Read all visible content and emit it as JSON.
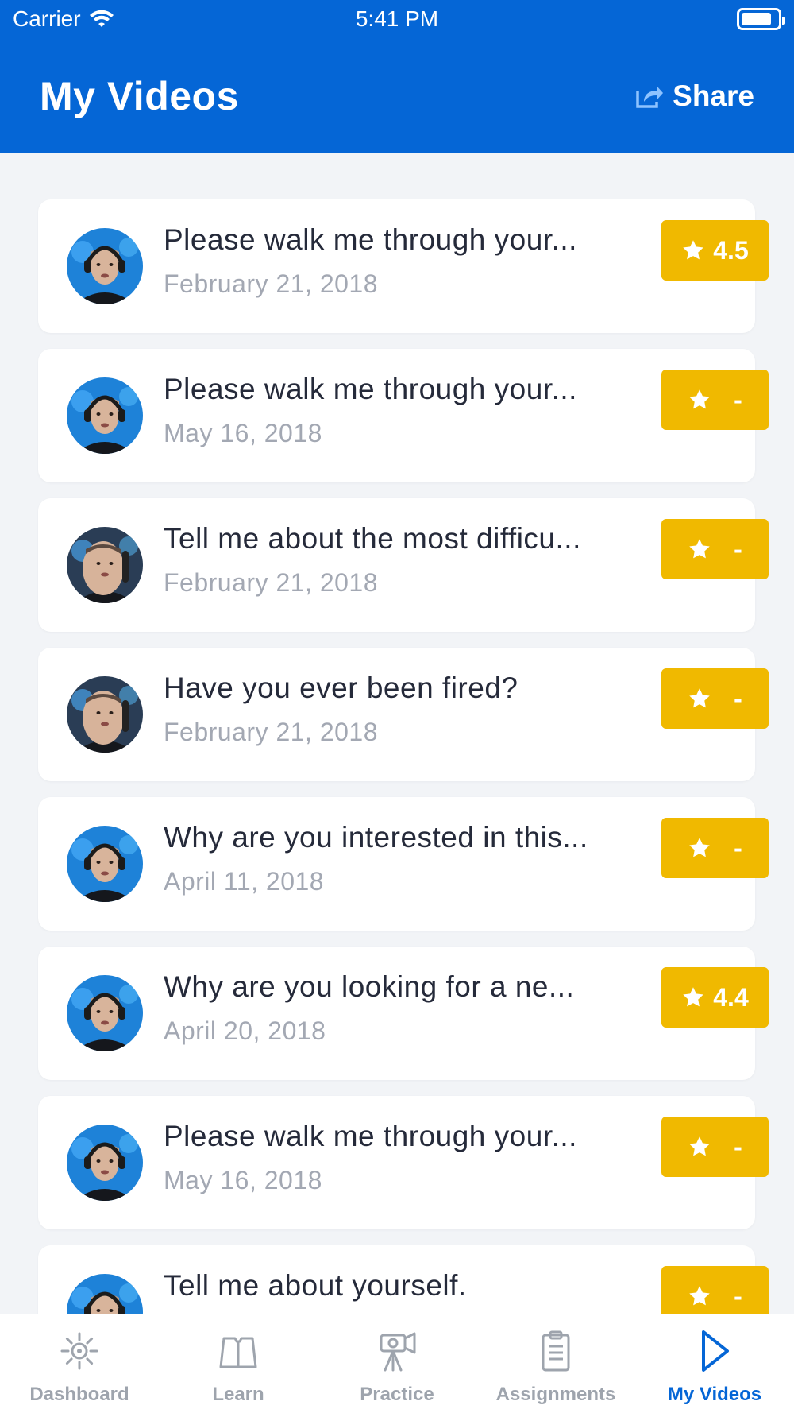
{
  "status_bar": {
    "carrier": "Carrier",
    "time": "5:41 PM",
    "battery_level": 0.85
  },
  "header": {
    "title": "My Videos",
    "share_label": "Share"
  },
  "videos": [
    {
      "title": "Please walk me through your...",
      "date": "February 21, 2018",
      "rating": "4.5",
      "avatar": "presenter-headset-1"
    },
    {
      "title": "Please walk me through your...",
      "date": "May 16, 2018",
      "rating": "-",
      "avatar": "presenter-headset-2"
    },
    {
      "title": "Tell me about the most difficu...",
      "date": "February 21, 2018",
      "rating": "-",
      "avatar": "presenter-closeup"
    },
    {
      "title": " Have you ever been fired?",
      "date": "February 21, 2018",
      "rating": "-",
      "avatar": "presenter-closeup"
    },
    {
      "title": "Why are you interested in this...",
      "date": "April 11, 2018",
      "rating": "-",
      "avatar": "presenter-headset-1"
    },
    {
      "title": "Why are you looking for a ne...",
      "date": "April 20, 2018",
      "rating": "4.4",
      "avatar": "presenter-headset-2"
    },
    {
      "title": "Please walk me through your...",
      "date": "May 16, 2018",
      "rating": "-",
      "avatar": "presenter-headset-1"
    },
    {
      "title": "Tell me about yourself.",
      "date": "",
      "rating": "-",
      "avatar": "presenter-headset-2"
    }
  ],
  "tabs": [
    {
      "label": "Dashboard",
      "icon": "sun-icon",
      "active": false
    },
    {
      "label": "Learn",
      "icon": "book-icon",
      "active": false
    },
    {
      "label": "Practice",
      "icon": "camera-icon",
      "active": false
    },
    {
      "label": "Assignments",
      "icon": "clipboard-icon",
      "active": false
    },
    {
      "label": "My Videos",
      "icon": "play-icon",
      "active": true
    }
  ],
  "colors": {
    "primary": "#0566d6",
    "rating": "#f0b900",
    "title_text": "#252a3a",
    "date_text": "#a3a8b3",
    "inactive_tab": "#9ea4ad"
  }
}
